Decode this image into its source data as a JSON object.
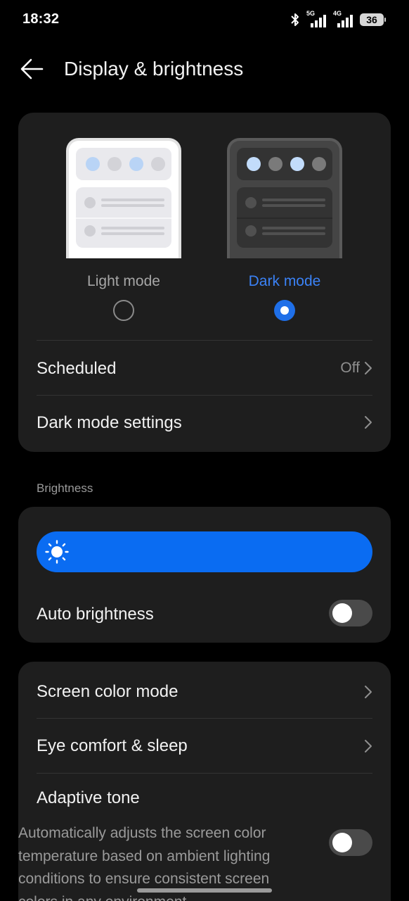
{
  "status_bar": {
    "time": "18:32",
    "network_1": "5G",
    "network_2": "4G",
    "battery": "36",
    "icons": [
      "bluetooth-icon",
      "signal-icon",
      "signal-icon",
      "battery-icon"
    ]
  },
  "header": {
    "title": "Display & brightness",
    "back_icon": "arrow-left-icon"
  },
  "theme": {
    "light_label": "Light mode",
    "dark_label": "Dark mode",
    "selected": "dark",
    "scheduled_label": "Scheduled",
    "scheduled_value": "Off",
    "dark_settings_label": "Dark mode settings"
  },
  "brightness": {
    "section_label": "Brightness",
    "level": 1.0,
    "slider_icon": "sun-icon",
    "auto_label": "Auto brightness",
    "auto_on": false
  },
  "display": {
    "screen_color_label": "Screen color mode",
    "eye_comfort_label": "Eye comfort & sleep",
    "adaptive_tone_label": "Adaptive tone",
    "adaptive_tone_desc": "Automatically adjusts the screen color temperature based on ambient lighting conditions to ensure consistent screen colors in any environment.",
    "adaptive_tone_on": false
  },
  "colors": {
    "accent": "#3b82f6",
    "slider": "#0a6cf2",
    "background": "#000000",
    "card": "#1e1e1e"
  }
}
